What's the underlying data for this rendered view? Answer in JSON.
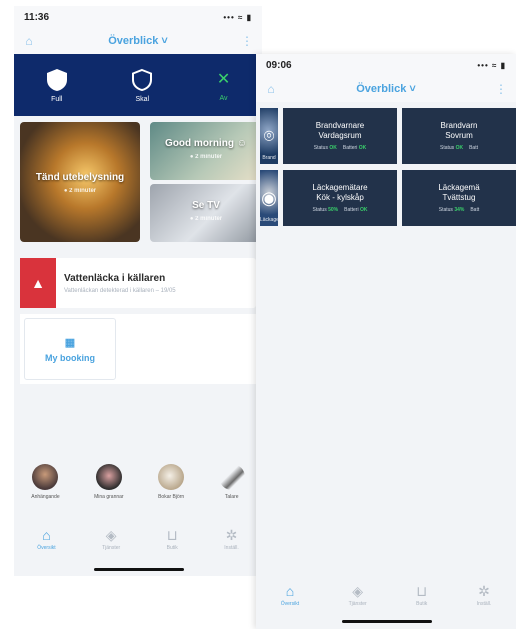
{
  "phone_a": {
    "status": {
      "time": "11:36",
      "signal": "••• ≈ ▮"
    },
    "header": {
      "title": "Överblick"
    },
    "arming": [
      {
        "label": "Full",
        "icon": "shield-icon"
      },
      {
        "label": "Skal",
        "icon": "shield-outline-icon"
      },
      {
        "label": "Av",
        "icon": "close-icon"
      }
    ],
    "scenes": [
      {
        "label": "Tänd utebelysning",
        "sub": "● 2 minuter"
      },
      {
        "label": "Good morning",
        "sub": "● 2 minuter"
      },
      {
        "label": "Se TV",
        "sub": "● 2 minuter"
      }
    ],
    "alert": {
      "title": "Vattenläcka i källaren",
      "subtitle": "Vattenläckan detekterad i källaren – 19/05"
    },
    "widget": {
      "label": "My booking"
    },
    "people": [
      "Anhängande",
      "Mina grannar",
      "Bokar Björn",
      "Talare"
    ],
    "tabs": [
      "Översikt",
      "Tjänster",
      "Butik",
      "Inställ."
    ]
  },
  "phone_b": {
    "status": {
      "time": "09:06",
      "signal": "••• ≈ ▮"
    },
    "header": {
      "title": "Överblick"
    },
    "devices": [
      {
        "thumb": "Brand",
        "name_line1": "Brandvarnare",
        "name_line2": "Vardagsrum",
        "status_label": "Status",
        "status": "OK",
        "battery_label": "Batteri",
        "battery": "OK"
      },
      {
        "thumb": "",
        "name_line1": "Brandvarn",
        "name_line2": "Sovrum",
        "status_label": "Status",
        "status": "OK",
        "battery_label": "Batt",
        "battery": ""
      },
      {
        "thumb": "Läckage",
        "name_line1": "Läckagemätare",
        "name_line2": "Kök - kylskåp",
        "status_label": "Status",
        "status": "50%",
        "battery_label": "Batteri",
        "battery": "OK"
      },
      {
        "thumb": "",
        "name_line1": "Läckagemä",
        "name_line2": "Tvättstug",
        "status_label": "Status",
        "status": "34%",
        "battery_label": "Batt",
        "battery": ""
      }
    ],
    "tabs": [
      "Översikt",
      "Tjänster",
      "Butik",
      "Inställ."
    ]
  },
  "colors": {
    "navy": "#0e2a6b",
    "accent": "#4aa3df",
    "alert_red": "#d9333c",
    "ok_green": "#3ad06b",
    "tile": "#22324a"
  }
}
